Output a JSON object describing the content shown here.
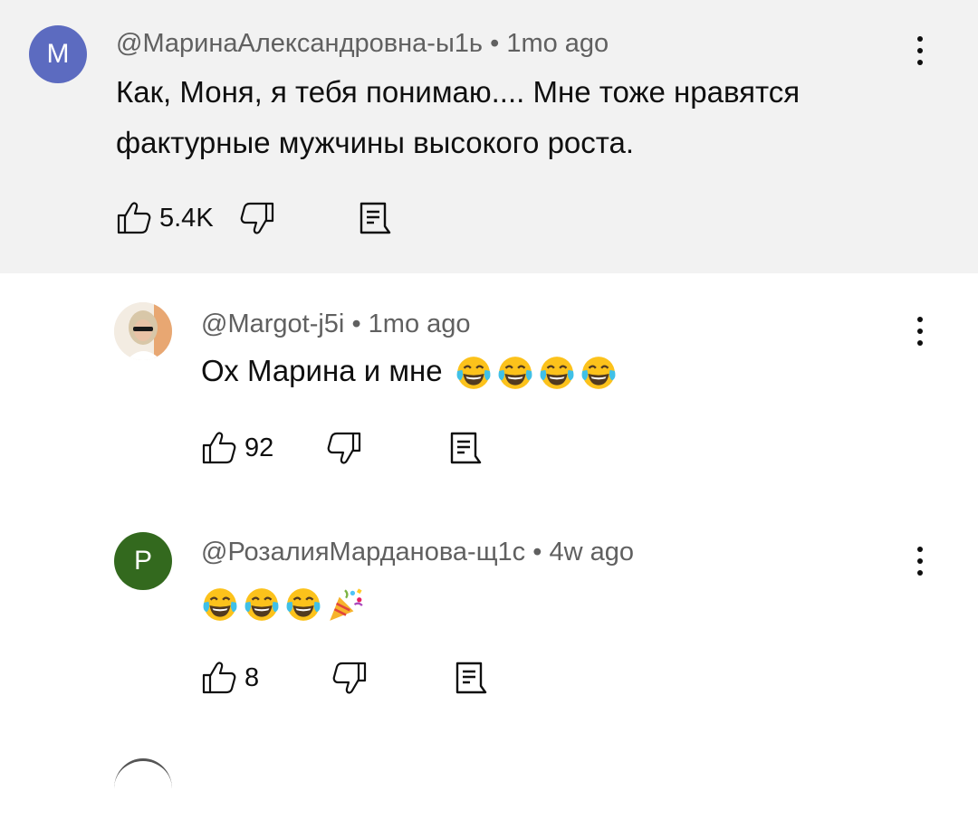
{
  "comments": [
    {
      "author": "@МаринаАлександровна-ы1ь",
      "separator": "•",
      "time": "1mo ago",
      "avatar_letter": "M",
      "avatar_color": "#5c6bc0",
      "text_line1": "Как, Моня, я тебя понимаю.... Мне тоже нравятся",
      "text_line2": "фактурные мужчины высокого роста.",
      "likes": "5.4K"
    },
    {
      "author": "@Margot-j5i",
      "separator": "•",
      "time": "1mo ago",
      "avatar_letter": "",
      "text": "Ох Марина и мне",
      "emojis": [
        "tears-of-joy-emoji",
        "tears-of-joy-emoji",
        "tears-of-joy-emoji",
        "tears-of-joy-emoji"
      ],
      "likes": "92"
    },
    {
      "author": "@РозалияМарданова-щ1с",
      "separator": "•",
      "time": "4w ago",
      "avatar_letter": "P",
      "avatar_color": "#33691e",
      "text": "",
      "emojis": [
        "tears-of-joy-emoji",
        "tears-of-joy-emoji",
        "tears-of-joy-emoji",
        "party-popper-emoji"
      ],
      "likes": "8"
    }
  ],
  "icons": {
    "like": "thumbs-up-icon",
    "dislike": "thumbs-down-icon",
    "reply": "reply-comment-icon",
    "menu": "more-vertical-icon"
  }
}
